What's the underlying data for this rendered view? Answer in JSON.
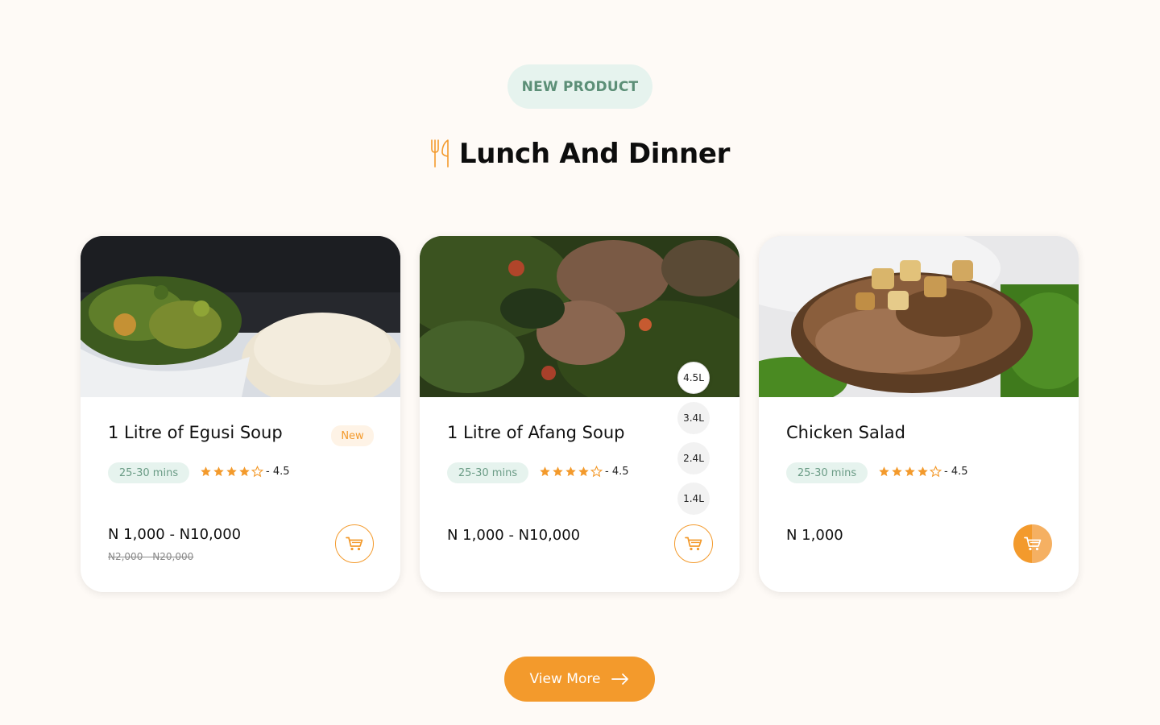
{
  "section": {
    "badge": "NEW PRODUCT",
    "title": "Lunch And Dinner"
  },
  "products": [
    {
      "title": "1 Litre of Egusi Soup",
      "tag": "New",
      "time": "25-30 mins",
      "rating_text": "- 4.5",
      "stars_filled": 4,
      "price": "N 1,000 - N10,000",
      "old_price": "N2,000 - N20,000"
    },
    {
      "title": "1 Litre of Afang Soup",
      "time": "25-30 mins",
      "rating_text": "- 4.5",
      "stars_filled": 4,
      "price": "N 1,000 - N10,000",
      "sizes": [
        "4.5L",
        "3.4L",
        "2.4L",
        "1.4L"
      ],
      "selected_size": "4.5L"
    },
    {
      "title": "Chicken Salad",
      "time": "25-30 mins",
      "rating_text": "- 4.5",
      "stars_filled": 4,
      "price": "N 1,000"
    }
  ],
  "view_more": {
    "label": "View More"
  },
  "colors": {
    "accent": "#f39a2c",
    "green_badge_bg": "#e6f3ee",
    "green_badge_text": "#5c8f77",
    "page_bg": "#fefaf6"
  },
  "icons": [
    "cutlery-icon",
    "star-icon",
    "star-outline-icon",
    "cart-icon",
    "arrow-right-icon"
  ]
}
